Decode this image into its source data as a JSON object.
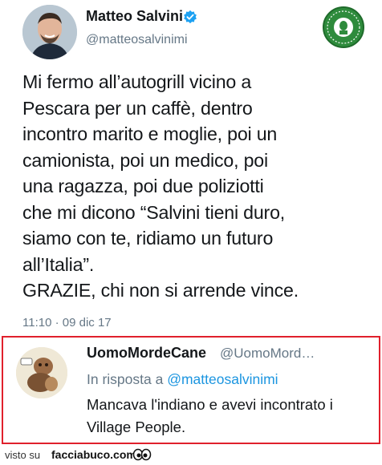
{
  "tweet": {
    "author_name": "Matteo Salvini",
    "author_handle": "@matteosalvinimi",
    "text_lines": [
      "Mi fermo all’autogrill vicino a",
      "Pescara per un caffè, dentro",
      "incontro marito e moglie, poi un",
      "camionista, poi un medico, poi",
      "una ragazza, poi due poliziotti",
      "che mi dicono “Salvini tieni duro,",
      "siamo con te, ridiamo un futuro",
      "all’Italia”.",
      "GRAZIE, chi non si arrende vince."
    ],
    "timestamp": "11:10 · 09 dic 17",
    "verified_icon": "verified-badge-icon",
    "stamp_logo_icon": "commenti-memorabili-stamp"
  },
  "reply": {
    "author_name": "UomoMordeCane",
    "author_handle": "@UomoMord…",
    "reply_prefix": "In risposta a",
    "reply_mention": "@matteosalvinimi",
    "text_lines": [
      "Mancava l'indiano e avevi incontrato i",
      "Village People."
    ],
    "highlight_color": "#e0202c"
  },
  "footer": {
    "visto_label": "visto su",
    "site_label": "facciabuco.com",
    "eyes_icon": "eyes-icon"
  },
  "colors": {
    "text": "#14171a",
    "secondary": "#657786",
    "link": "#1b95e0",
    "verified": "#1da1f2"
  }
}
